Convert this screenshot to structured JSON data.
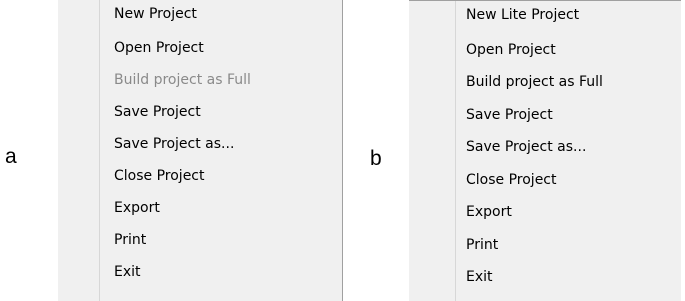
{
  "panels": [
    {
      "label": "a",
      "items": [
        {
          "label": "New Project",
          "enabled": true
        },
        {
          "label": "Open Project",
          "enabled": true
        },
        {
          "label": "Build project as Full",
          "enabled": false
        },
        {
          "label": "Save Project",
          "enabled": true
        },
        {
          "label": "Save Project as...",
          "enabled": true
        },
        {
          "label": "Close Project",
          "enabled": true
        },
        {
          "label": "Export",
          "enabled": true
        },
        {
          "label": "Print",
          "enabled": true
        },
        {
          "label": "Exit",
          "enabled": true
        }
      ]
    },
    {
      "label": "b",
      "items": [
        {
          "label": "New Lite Project",
          "enabled": true
        },
        {
          "label": "Open Project",
          "enabled": true
        },
        {
          "label": "Build project as Full",
          "enabled": true
        },
        {
          "label": "Save Project",
          "enabled": true
        },
        {
          "label": "Save Project as...",
          "enabled": true
        },
        {
          "label": "Close Project",
          "enabled": true
        },
        {
          "label": "Export",
          "enabled": true
        },
        {
          "label": "Print",
          "enabled": true
        },
        {
          "label": "Exit",
          "enabled": true
        }
      ]
    }
  ],
  "colors": {
    "menu_background": "#f0f0f0",
    "disabled_text": "#8a8a8a",
    "enabled_text": "#000000"
  }
}
